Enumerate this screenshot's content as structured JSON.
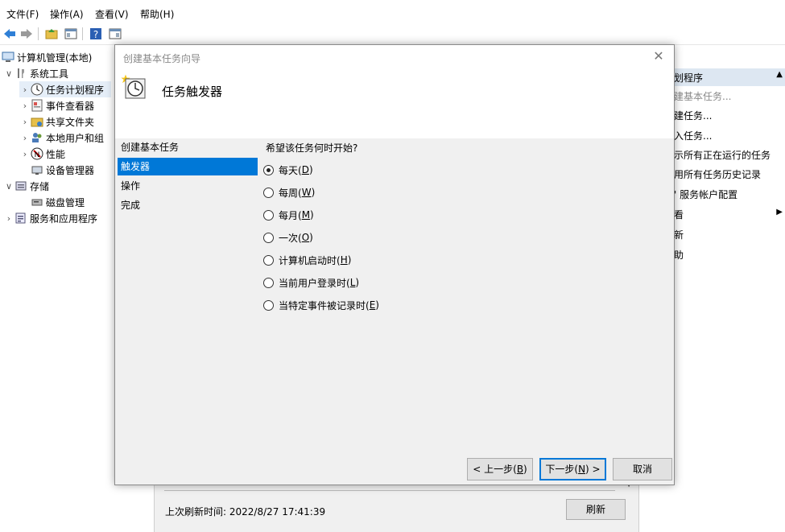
{
  "menubar": {
    "file": "文件(F)",
    "action": "操作(A)",
    "view": "查看(V)",
    "help": "帮助(H)"
  },
  "tree": {
    "root": "计算机管理(本地)",
    "system_tools": "系统工具",
    "task_scheduler": "任务计划程序",
    "event_viewer": "事件查看器",
    "shared_folders": "共享文件夹",
    "local_users": "本地用户和组",
    "performance": "性能",
    "device_manager": "设备管理器",
    "storage": "存储",
    "disk_management": "磁盘管理",
    "services_apps": "服务和应用程序"
  },
  "status": {
    "last_refresh": "上次刷新时间: 2022/8/27 17:41:39",
    "refresh_button": "刷新"
  },
  "actions_pane": {
    "header": "划程序",
    "items": [
      "建基本任务...",
      "建任务...",
      "入任务...",
      "示所有正在运行的任务",
      "用所有任务历史记录",
      "' 服务帐户配置",
      "看",
      "新",
      "助"
    ]
  },
  "dialog": {
    "title": "创建基本任务向导",
    "heading": "任务触发器",
    "steps": [
      "创建基本任务",
      "触发器",
      "操作",
      "完成"
    ],
    "active_step": 1,
    "question": "希望该任务何时开始?",
    "options": [
      {
        "text": "每天(",
        "key": "D",
        "end": ")",
        "checked": true
      },
      {
        "text": "每周(",
        "key": "W",
        "end": ")",
        "checked": false
      },
      {
        "text": "每月(",
        "key": "M",
        "end": ")",
        "checked": false
      },
      {
        "text": "一次(",
        "key": "O",
        "end": ")",
        "checked": false
      },
      {
        "text": "计算机启动时(",
        "key": "H",
        "end": ")",
        "checked": false
      },
      {
        "text": "当前用户登录时(",
        "key": "L",
        "end": ")",
        "checked": false
      },
      {
        "text": "当特定事件被记录时(",
        "key": "E",
        "end": ")",
        "checked": false
      }
    ],
    "buttons": {
      "back_pre": "< 上一步(",
      "back_key": "B",
      "back_post": ")",
      "next_pre": "下一步(",
      "next_key": "N",
      "next_post": ") >",
      "cancel": "取消"
    }
  },
  "colors": {
    "selection": "#0078d7",
    "dialog_bg": "#f0f0f0",
    "actions_header_bg": "#dde7f2"
  }
}
